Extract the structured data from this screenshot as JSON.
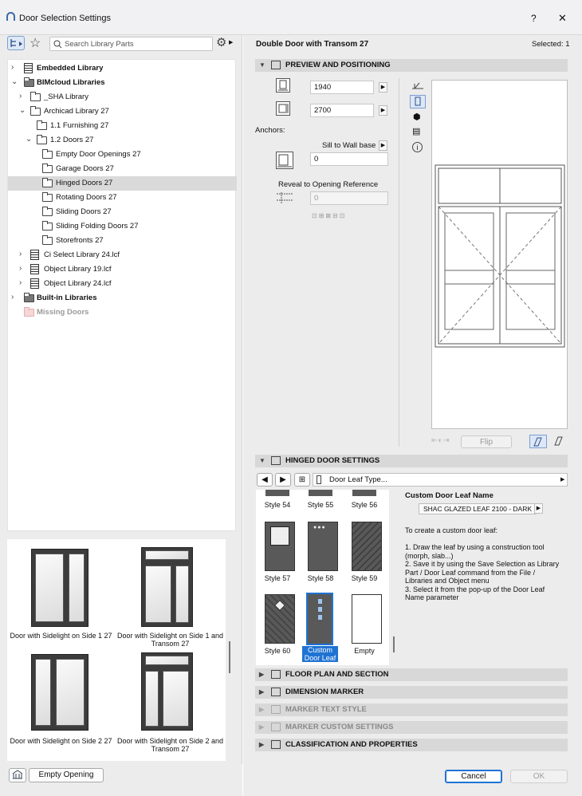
{
  "window": {
    "title": "Door Selection Settings",
    "help": "?",
    "close": "✕"
  },
  "left": {
    "search_placeholder": "Search Library Parts",
    "tree": [
      {
        "label": "Embedded Library",
        "bold": true
      },
      {
        "label": "BIMcloud Libraries",
        "bold": true
      },
      {
        "label": "_SHA Library"
      },
      {
        "label": "Archicad Library 27"
      },
      {
        "label": "1.1 Furnishing 27"
      },
      {
        "label": "1.2 Doors 27"
      },
      {
        "label": "Empty Door Openings 27"
      },
      {
        "label": "Garage Doors 27"
      },
      {
        "label": "Hinged Doors 27",
        "selected": true
      },
      {
        "label": "Rotating Doors 27"
      },
      {
        "label": "Sliding Doors 27"
      },
      {
        "label": "Sliding Folding Doors 27"
      },
      {
        "label": "Storefronts 27"
      },
      {
        "label": "Ci Select Library 24.lcf"
      },
      {
        "label": "Object Library 19.lcf"
      },
      {
        "label": "Object Library 24.lcf"
      },
      {
        "label": "Built-in Libraries",
        "bold": true
      },
      {
        "label": "Missing Doors",
        "bold": true,
        "muted": true
      }
    ],
    "gallery": [
      {
        "caption": "Door with Sidelight on Side 1 27"
      },
      {
        "caption": "Door with Sidelight on Side 1 and Transom 27"
      },
      {
        "caption": "Door with Sidelight on Side 2 27"
      },
      {
        "caption": "Door with Sidelight on Side 2 and Transom 27"
      }
    ],
    "empty_opening": "Empty Opening"
  },
  "right": {
    "object_name": "Double Door with Transom 27",
    "selected": "Selected: 1",
    "sections": {
      "preview": "PREVIEW AND POSITIONING",
      "hinged": "HINGED DOOR SETTINGS",
      "floor": "FLOOR PLAN AND SECTION",
      "dimension": "DIMENSION MARKER",
      "marker_text": "MARKER TEXT STYLE",
      "marker_custom": "MARKER CUSTOM SETTINGS",
      "classification": "CLASSIFICATION AND PROPERTIES"
    },
    "width_value": "1940",
    "height_value": "2700",
    "anchors_label": "Anchors:",
    "sill_label": "Sill to Wall base",
    "sill_value": "0",
    "reveal_label": "Reveal to Opening Reference",
    "reveal_value": "0",
    "flip_label": "Flip",
    "door_leaf_type": "Door Leaf Type...",
    "leaf_styles": [
      {
        "label": "Style 54"
      },
      {
        "label": "Style 55"
      },
      {
        "label": "Style 56"
      },
      {
        "label": "Style 57"
      },
      {
        "label": "Style 58"
      },
      {
        "label": "Style 59"
      },
      {
        "label": "Style 60"
      },
      {
        "label": "Custom Door Leaf",
        "selected": true
      },
      {
        "label": "Empty"
      }
    ],
    "custom_leaf_title": "Custom Door Leaf Name",
    "custom_leaf_value": "SHAC GLAZED LEAF 2100 - DARK",
    "custom_help_intro": "To create a custom door leaf:",
    "custom_help_steps": "1. Draw the leaf by using a construction tool (morph, slab...)\n2. Save it by using the Save Selection as Library Part / Door Leaf command from the File / Libraries and Object menu\n3. Select it from the pop-up of the Door Leaf Name parameter",
    "cancel": "Cancel",
    "ok": "OK"
  }
}
